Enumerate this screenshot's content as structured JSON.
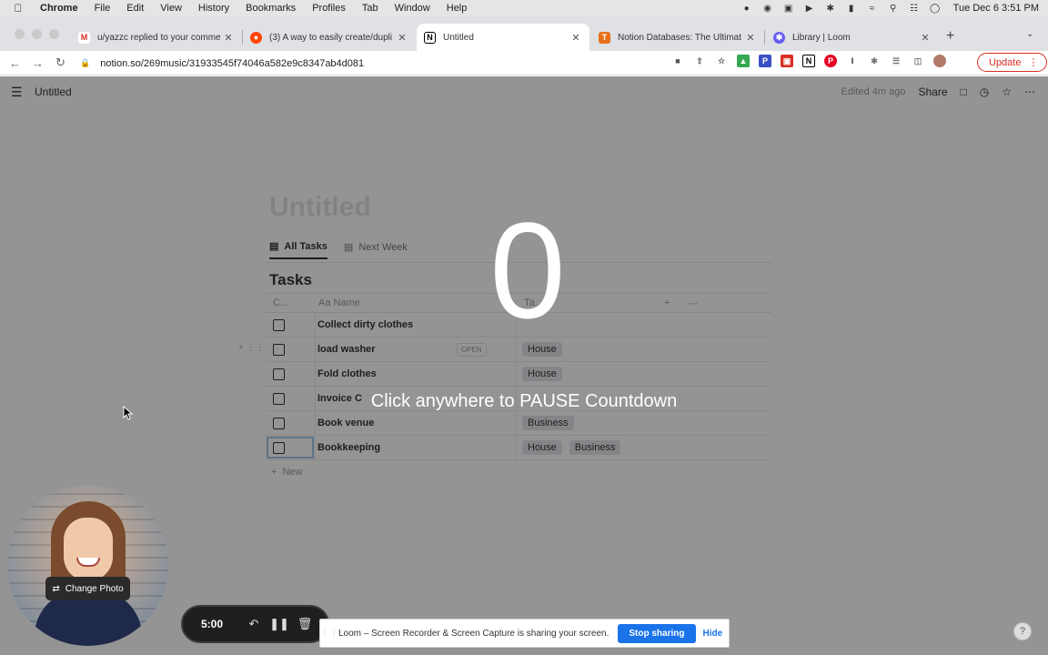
{
  "menubar": {
    "app": "Chrome",
    "items": [
      "File",
      "Edit",
      "View",
      "History",
      "Bookmarks",
      "Profiles",
      "Tab",
      "Window",
      "Help"
    ],
    "clock": "Tue Dec 6  3:51 PM"
  },
  "tabs": [
    {
      "title": "u/yazzc replied to your comme",
      "icon": "gmail-icon",
      "color": "#d93025"
    },
    {
      "title": "(3) A way to easily create/dupli",
      "icon": "reddit-icon",
      "color": "#ff4500"
    },
    {
      "title": "Untitled",
      "icon": "notion-icon",
      "color": "#000000"
    },
    {
      "title": "Notion Databases: The Ultimat",
      "icon": "tf-icon",
      "color": "#e8711a"
    },
    {
      "title": "Library | Loom",
      "icon": "loom-icon",
      "color": "#625df5"
    }
  ],
  "address": {
    "url": "notion.so/269music/31933545f74046a582e9c8347ab4d081",
    "update_label": "Update"
  },
  "notion": {
    "breadcrumb": "Untitled",
    "edited": "Edited 4m ago",
    "share": "Share",
    "page_title": "Untitled",
    "views": [
      "All Tasks",
      "Next Week"
    ],
    "db_title": "Tasks",
    "columns": [
      "C...",
      "Aa  Name",
      "Ta..."
    ],
    "rows": [
      {
        "name": "Collect dirty clothes",
        "tags": []
      },
      {
        "name": "load washer",
        "tags": [
          "House"
        ]
      },
      {
        "name": "Fold clothes",
        "tags": [
          "House"
        ]
      },
      {
        "name": "Invoice C",
        "tags": []
      },
      {
        "name": "Book venue",
        "tags": [
          "Business"
        ]
      },
      {
        "name": "Bookkeeping",
        "tags": [
          "House",
          "Business"
        ]
      }
    ],
    "open_label": "OPEN",
    "new_label": "New"
  },
  "countdown": {
    "number": "0",
    "message": "Click anywhere to PAUSE Countdown"
  },
  "camera": {
    "change_photo": "Change Photo"
  },
  "loom": {
    "time": "5:00"
  },
  "sharebar": {
    "message": "Loom – Screen Recorder & Screen Capture is sharing your screen.",
    "stop": "Stop sharing",
    "hide": "Hide"
  },
  "help": "?"
}
